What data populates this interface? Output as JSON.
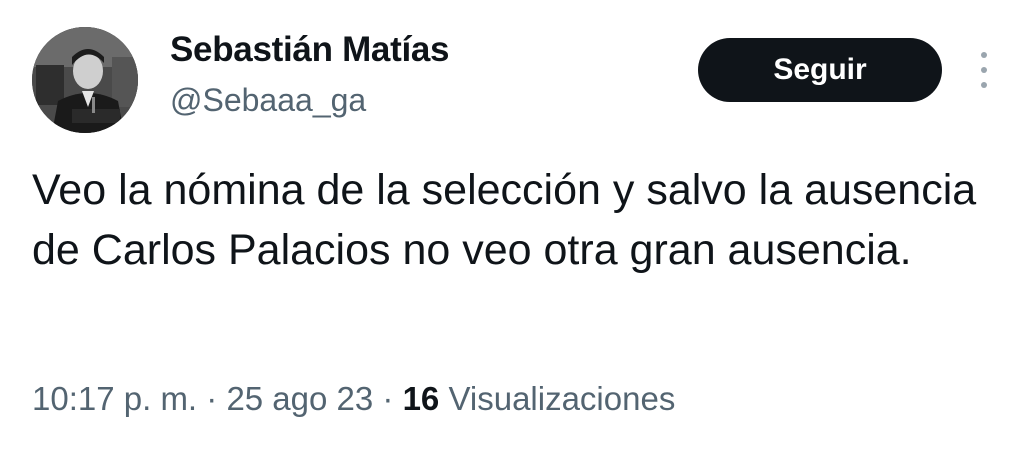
{
  "author": {
    "display_name": "Sebastián Matías",
    "handle": "@Sebaaa_ga"
  },
  "actions": {
    "follow_label": "Seguir",
    "more_icon": "more-vertical-icon"
  },
  "tweet": {
    "text": "Veo la nómina de la selección y salvo la ausencia de Carlos Palacios no veo otra gran ausencia."
  },
  "meta": {
    "time": "10:17 p. m.",
    "separator": " · ",
    "date": "25 ago 23",
    "views_count": "16",
    "views_label": "Visualizaciones"
  },
  "colors": {
    "text_primary": "#0f1419",
    "text_secondary": "#536471",
    "button_bg": "#0f1419",
    "button_text": "#ffffff"
  }
}
